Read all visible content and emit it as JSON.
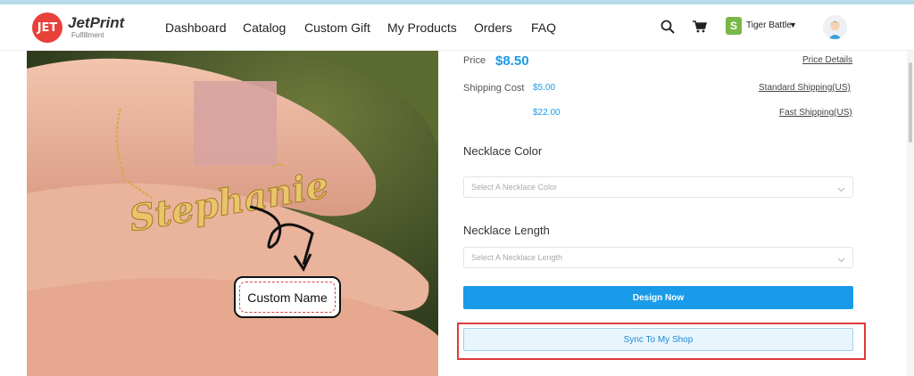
{
  "logo": {
    "badge": "JET",
    "name": "JetPrint",
    "sub": "Fulfillment"
  },
  "nav": {
    "items": [
      "Dashboard",
      "Catalog",
      "Custom Gift",
      "My Products",
      "Orders",
      "FAQ"
    ]
  },
  "header_right": {
    "shop_name": "Tiger Battle",
    "icons": [
      "search-icon",
      "cart-icon",
      "shop-icon",
      "chevron-down-icon",
      "avatar"
    ]
  },
  "photo": {
    "necklace_text": "Stephanie",
    "label": "Custom Name"
  },
  "pricing": {
    "price_label": "Price",
    "price": "$8.50",
    "price_details": "Price Details",
    "shipping_label": "Shipping Cost",
    "shipping_options": [
      {
        "price": "$5.00",
        "name": "Standard Shipping(US)"
      },
      {
        "price": "$22.00",
        "name": "Fast Shipping(US)"
      }
    ]
  },
  "options": {
    "color": {
      "title": "Necklace Color",
      "placeholder": "Select A Necklace Color"
    },
    "length": {
      "title": "Necklace Length",
      "placeholder": "Select A Necklace Length"
    }
  },
  "actions": {
    "design_now": "Design Now",
    "sync": "Sync To My Shop"
  },
  "colors": {
    "accent": "#1a9bea",
    "highlight_border": "#e03a3a",
    "top_strip": "#b7dde8"
  }
}
